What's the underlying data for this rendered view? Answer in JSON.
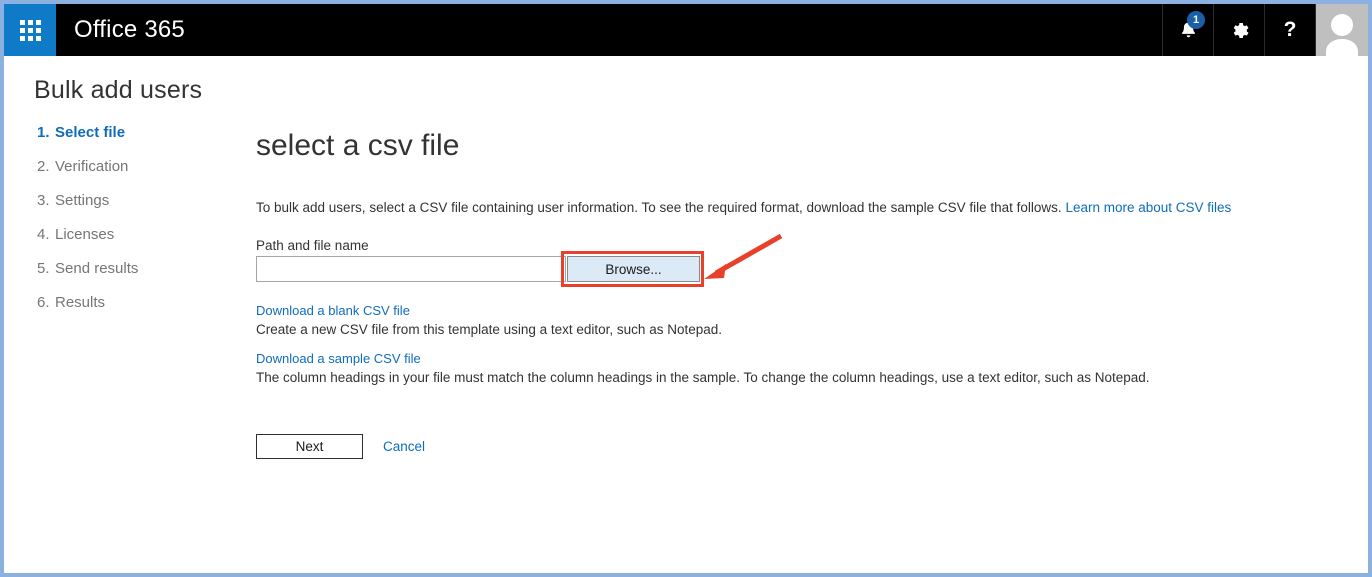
{
  "suite_bar": {
    "app_launcher_icon": "waffle-grid-icon",
    "brand": "Office 365",
    "notifications": {
      "icon": "bell-icon",
      "count": "1"
    },
    "settings_icon": "gear-icon",
    "help_label": "?",
    "avatar_icon": "user-avatar-icon"
  },
  "page": {
    "title": "Bulk add users"
  },
  "steps": [
    {
      "num": "1.",
      "label": "Select file",
      "active": true
    },
    {
      "num": "2.",
      "label": "Verification",
      "active": false
    },
    {
      "num": "3.",
      "label": "Settings",
      "active": false
    },
    {
      "num": "4.",
      "label": "Licenses",
      "active": false
    },
    {
      "num": "5.",
      "label": "Send results",
      "active": false
    },
    {
      "num": "6.",
      "label": "Results",
      "active": false
    }
  ],
  "main": {
    "heading": "select a csv file",
    "intro_text": "To bulk add users, select a CSV file containing user information. To see the required format, download the sample CSV file that follows. ",
    "intro_link": "Learn more about CSV files",
    "field_label": "Path and file name",
    "path_value": "",
    "path_placeholder": "",
    "browse_label": "Browse...",
    "downloads": [
      {
        "link": "Download a blank CSV file",
        "desc": "Create a new CSV file from this template using a text editor, such as Notepad."
      },
      {
        "link": "Download a sample CSV file",
        "desc": "The column headings in your file must match the column headings in the sample. To change the column headings, use a text editor, such as Notepad."
      }
    ],
    "next_label": "Next",
    "cancel_label": "Cancel"
  },
  "annotations": {
    "highlight_target": "browse-button",
    "highlight_color": "#e8402a",
    "arrow_color": "#e8402a"
  },
  "colors": {
    "accent_blue": "#0f6cbd",
    "waffle_tile": "#0f7ac8",
    "suite_bar": "#000000",
    "frame_border": "#8cb0e0",
    "browse_fill": "#dce9f7"
  }
}
